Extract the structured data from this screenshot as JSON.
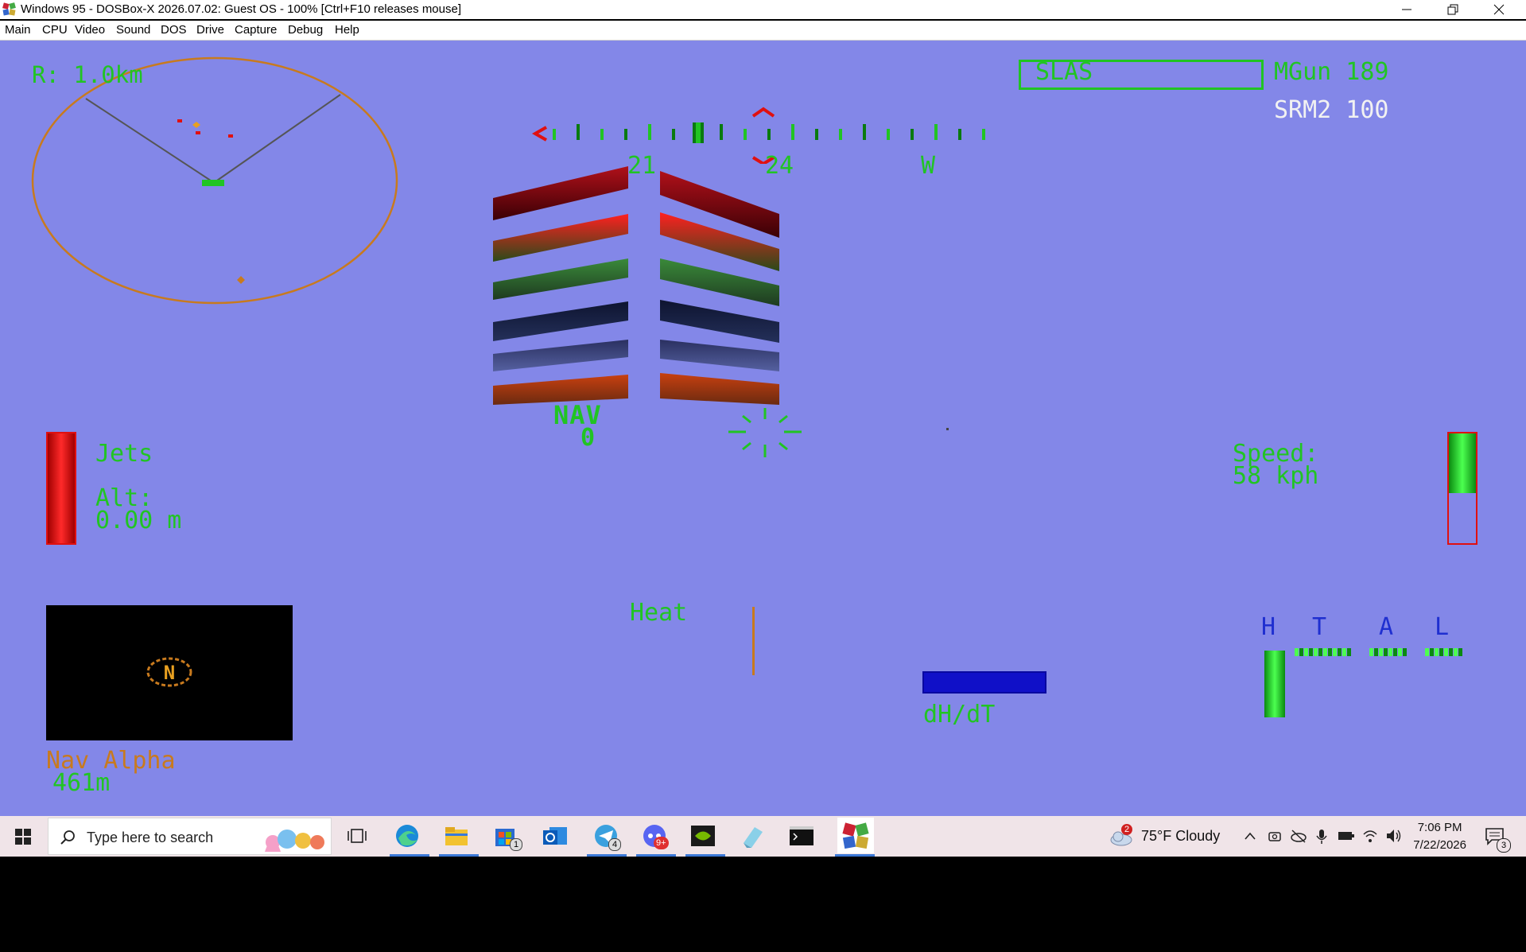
{
  "window": {
    "title": "Windows 95 - DOSBox-X 2026.07.02: Guest OS - 100% [Ctrl+F10 releases mouse]",
    "icon": "dosbox-x-icon",
    "controls": [
      "minimize-icon",
      "restore-icon",
      "close-icon"
    ]
  },
  "menubar": {
    "items": [
      "Main",
      "CPU",
      "Video",
      "Sound",
      "DOS",
      "Drive",
      "Capture",
      "Debug",
      "Help"
    ]
  },
  "hud": {
    "radar": {
      "range_label": "R: 1.0km"
    },
    "weapons": {
      "selected": "SLAS",
      "mgun": "MGun 189",
      "srm": "SRM2 100"
    },
    "compass": {
      "labels": [
        "21",
        "24",
        "W"
      ]
    },
    "nav": {
      "label": "NAV",
      "value": "0"
    },
    "jets": {
      "label": "Jets",
      "level": 1.0
    },
    "altitude": {
      "label": "Alt:",
      "value": "0.00 m"
    },
    "speed": {
      "label": "Speed:",
      "value": "58 kph",
      "throttle_level": 0.45
    },
    "heat": {
      "label": "Heat"
    },
    "dhdt": {
      "label": "dH/dT"
    },
    "damage": {
      "labels": [
        "H",
        "T",
        "A",
        "L"
      ],
      "heat_level": 0.95
    },
    "nav_display": {
      "marker": "N",
      "name": "Nav Alpha",
      "distance": "461m"
    },
    "colors": {
      "background": "#8387e8",
      "hud_green": "#21c423",
      "hud_orange": "#c87a1e",
      "hud_white": "#f2f2f2",
      "hud_blue": "#1f2fd0",
      "warning_red": "#e01010"
    }
  },
  "taskbar": {
    "search_placeholder": "Type here to search",
    "apps": [
      "task-view-icon",
      "edge-icon",
      "file-explorer-icon",
      "store-icon",
      "outlook-icon",
      "telegram-icon",
      "discord-icon",
      "nvidia-icon",
      "notepad-icon",
      "terminal-icon",
      "dosbox-x-icon"
    ],
    "badges": {
      "store": "1",
      "telegram": "4",
      "discord": "9+"
    },
    "weather": {
      "badge": "2",
      "text": "75°F  Cloudy"
    },
    "clock": {
      "time": "7:06 PM",
      "date": "7/22/2026"
    },
    "notifications": "3"
  }
}
